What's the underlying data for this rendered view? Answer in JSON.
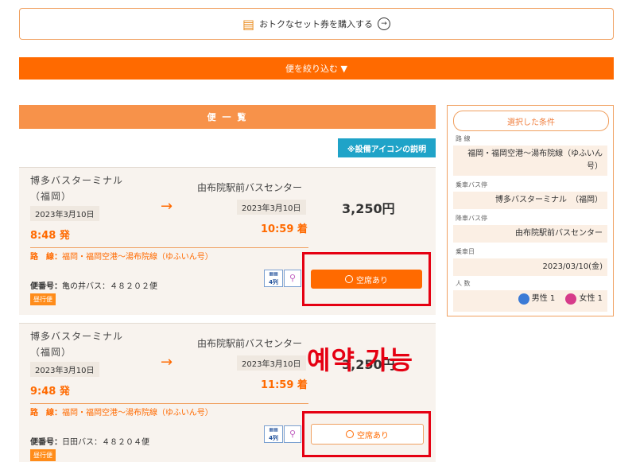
{
  "set_ticket": {
    "label": "おトクなセット券を購入する"
  },
  "filter": {
    "label": "便を絞り込む ▼"
  },
  "list_header": {
    "label": "便 一 覧"
  },
  "facility_button": {
    "label": "※設備アイコンの説明"
  },
  "cards": [
    {
      "from_line1": "博多バスターミナル",
      "from_line2": "（福岡）",
      "from_date": "2023年3月10日",
      "dep_time": "8:48 発",
      "to": "由布院駅前バスセンター",
      "to_date": "2023年3月10日",
      "arr_time": "10:59 着",
      "price": "3,250円",
      "route_label": "路　線：",
      "route": "福岡・福岡空港～湯布院線（ゆふいん号）",
      "bin_label": "便番号：",
      "bin": "亀の井バス：４８２０２便",
      "badge": "昼行便",
      "seat_icon": "4列",
      "vacant": "空席あり"
    },
    {
      "from_line1": "博多バスターミナル",
      "from_line2": "（福岡）",
      "from_date": "2023年3月10日",
      "dep_time": "9:48 発",
      "to": "由布院駅前バスセンター",
      "to_date": "2023年3月10日",
      "arr_time": "11:59 着",
      "price": "3,250円",
      "route_label": "路　線：",
      "route": "福岡・福岡空港～湯布院線（ゆふいん号）",
      "bin_label": "便番号：",
      "bin": "日田バス：４８２０４便",
      "badge": "昼行便",
      "seat_icon": "4列",
      "vacant": "空席あり"
    }
  ],
  "sidebar": {
    "title": "選択した条件",
    "route_label": "路 線",
    "route": "福岡・福岡空港～湯布院線（ゆふいん号）",
    "board_label": "乗車バス停",
    "board": "博多バスターミナル　（福岡）",
    "alight_label": "降車バス停",
    "alight": "由布院駅前バスセンター",
    "date_label": "乗車日",
    "date": "2023/03/10(金)",
    "people_label": "人 数",
    "male": "男性 1",
    "female": "女性 1"
  },
  "overlay": {
    "text": "예약 가능"
  },
  "colors": {
    "accent": "#ff6a00",
    "highlight": "#e50012",
    "info": "#1fa3c8"
  }
}
